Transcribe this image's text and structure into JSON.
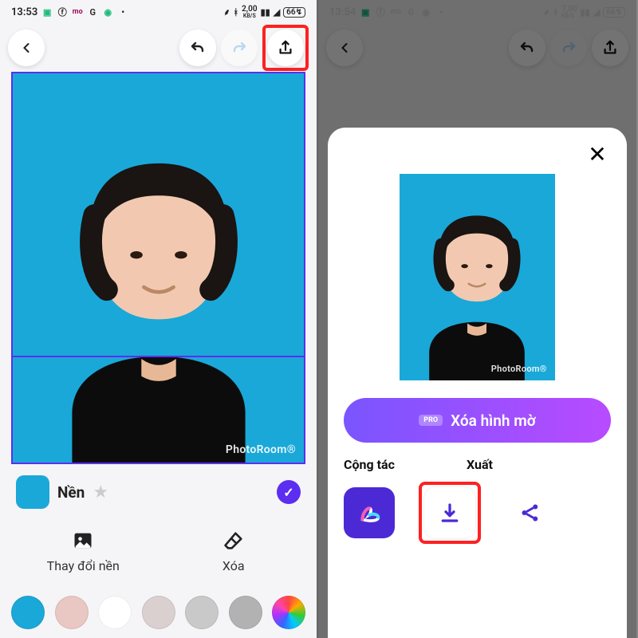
{
  "status": {
    "time": "13:53",
    "data_left": "2,00",
    "data_unit_left": "KB/S",
    "data_right": "7,00",
    "data_unit_right": "KB/S",
    "battery": "66"
  },
  "editor": {
    "watermark": "PhotoRoom®",
    "bg_label": "Nền",
    "action_change_bg": "Thay đổi nền",
    "action_erase": "Xóa",
    "palette": [
      "#1aa8d8",
      "#e9c7c2",
      "#ffffff",
      "#d9d0cf",
      "#c9c9c9",
      "#b2b2b2",
      "rainbow"
    ]
  },
  "modal": {
    "cta_label": "Xóa hình mờ",
    "pro": "PRO",
    "section_collab": "Cộng tác",
    "section_export": "Xuất"
  }
}
